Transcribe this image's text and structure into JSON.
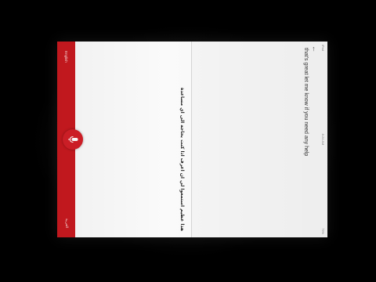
{
  "status_bar": {
    "left": "iPad",
    "time": "8:24 AM",
    "right": "79%"
  },
  "source": {
    "text": "that's great let me know if you need any help"
  },
  "target": {
    "text": "هذا عظيم استمعوا لي ان اعرف اذا كنت بحاجة الى اي مساعدة"
  },
  "languages": {
    "source": "English",
    "target": "العربية"
  },
  "colors": {
    "accent": "#c8191f",
    "background": "#f5f5f5"
  },
  "icons": {
    "back": "back-arrow-icon",
    "mic": "microphone-icon"
  }
}
